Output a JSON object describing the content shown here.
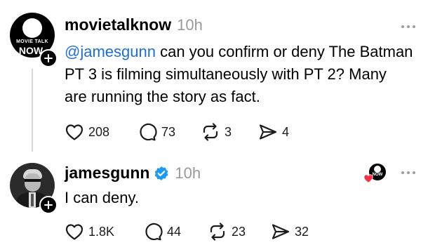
{
  "post1": {
    "avatar_text_line1": "MOVIE TALK",
    "avatar_text_line2": "NOW",
    "username": "movietalknow",
    "time": "10h",
    "mention": "@jamesgunn",
    "line1_rest": " can you confirm or deny The Batman",
    "line2": "PT 3 is filming simultaneously with PT 2? Many",
    "line3": "are running the story as fact.",
    "likes": "208",
    "replies": "73",
    "reposts": "3",
    "shares": "4"
  },
  "post2": {
    "username": "jamesgunn",
    "verified": true,
    "time": "10h",
    "text": "I can deny.",
    "likes": "1.8K",
    "replies": "44",
    "reposts": "23",
    "shares": "32",
    "liked_by_avatar_text": "NOW"
  },
  "icons": {
    "like": "heart-icon",
    "reply": "comment-icon",
    "repost": "repost-icon",
    "share": "send-icon",
    "more": "more-dots-icon",
    "follow": "plus-icon",
    "verified": "verified-badge-icon"
  },
  "colors": {
    "mention": "#1d6fd6",
    "verified": "#1d9bf0",
    "liked_heart": "#ff3040",
    "muted": "#9a9a9a"
  }
}
